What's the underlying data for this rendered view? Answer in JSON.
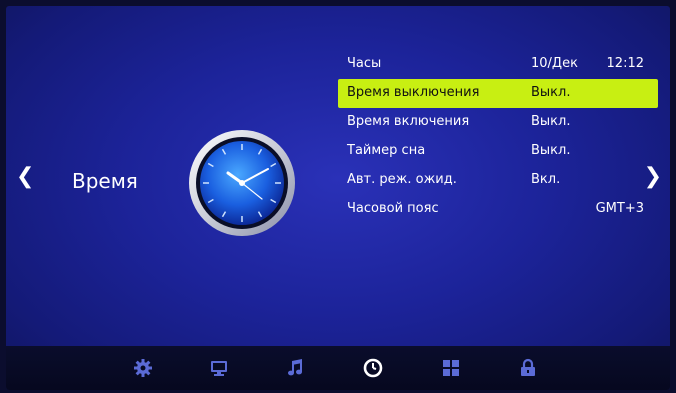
{
  "section": {
    "title": "Время",
    "prev_arrow": "❮",
    "next_arrow": "❯"
  },
  "menu": {
    "items": [
      {
        "label": "Часы",
        "value": "10/Дек",
        "value2": "12:12"
      },
      {
        "label": "Время выключения",
        "value": "Выкл."
      },
      {
        "label": "Время включения",
        "value": "Выкл."
      },
      {
        "label": "Таймер сна",
        "value": "Выкл."
      },
      {
        "label": "Авт. реж. ожид.",
        "value": "Вкл."
      },
      {
        "label": "Часовой пояс",
        "value": "GMT+3"
      }
    ],
    "selected_index": 1
  },
  "bottom_nav": {
    "items": [
      {
        "icon": "gear-icon"
      },
      {
        "icon": "picture-icon"
      },
      {
        "icon": "music-note-icon"
      },
      {
        "icon": "clock-icon",
        "active": true
      },
      {
        "icon": "grid-icon"
      },
      {
        "icon": "lock-icon"
      }
    ]
  },
  "colors": {
    "highlight": "#c8ef12",
    "background": "#1c2399",
    "icon_accent": "#5b6bd6",
    "icon_active": "#ffffff"
  }
}
